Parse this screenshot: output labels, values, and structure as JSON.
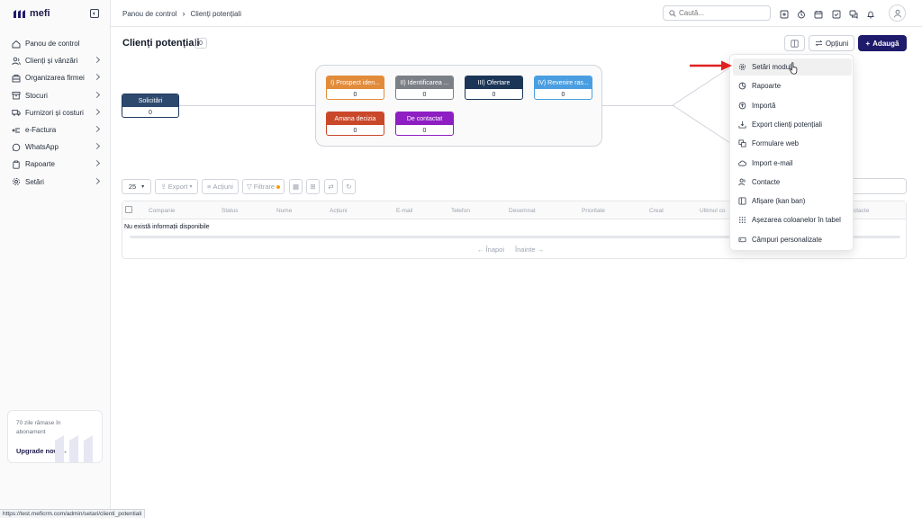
{
  "app": {
    "logo_text": "mefi"
  },
  "sidebar": {
    "items": [
      {
        "label": "Panou de control",
        "icon": "home-icon",
        "chevron": false
      },
      {
        "label": "Clienți și vânzări",
        "icon": "users-icon",
        "chevron": true
      },
      {
        "label": "Organizarea firmei",
        "icon": "building-icon",
        "chevron": true
      },
      {
        "label": "Stocuri",
        "icon": "box-icon",
        "chevron": true
      },
      {
        "label": "Furnizori și costuri",
        "icon": "truck-icon",
        "chevron": true
      },
      {
        "label": "e-Factura",
        "icon": "invoice-icon",
        "chevron": true
      },
      {
        "label": "WhatsApp",
        "icon": "whatsapp-icon",
        "chevron": true
      },
      {
        "label": "Rapoarte",
        "icon": "clipboard-icon",
        "chevron": true
      },
      {
        "label": "Setări",
        "icon": "gear-icon",
        "chevron": true
      }
    ],
    "upgrade": {
      "text": "70 zile rămase în abonament",
      "link": "Upgrade now"
    }
  },
  "topbar": {
    "breadcrumb": [
      "Panou de control",
      "Clienți potențiali"
    ],
    "search_placeholder": "Caută..."
  },
  "page": {
    "title": "Clienți potențiali",
    "count": "0",
    "options_label": "Opțiuni",
    "add_label": "Adaugă"
  },
  "funnel": {
    "source": {
      "label": "Solicitări",
      "value": "0",
      "color": "#2d4a6e"
    },
    "stages": [
      {
        "label": "I) Prospect iden...",
        "value": "0",
        "color": "#e28b3a"
      },
      {
        "label": "II) Identificarea ...",
        "value": "0",
        "color": "#7b7f86"
      },
      {
        "label": "III) Ofertare",
        "value": "0",
        "color": "#1b3556"
      },
      {
        "label": "IV) Revenire ras...",
        "value": "0",
        "color": "#4a9ee0"
      },
      {
        "label": "Amana decizia",
        "value": "0",
        "color": "#c9482a"
      },
      {
        "label": "De contactat",
        "value": "0",
        "color": "#8e1fc2"
      }
    ]
  },
  "table": {
    "page_size": "25",
    "toolbar": {
      "export": "Export",
      "actions": "Acțiuni",
      "filter": "Filtrare"
    },
    "columns": [
      "Companie",
      "Status",
      "Nume",
      "Acțiuni",
      "E-mail",
      "Telefon",
      "Desemnat",
      "Prioritate",
      "Creat",
      "Ultimul co",
      "ctacte"
    ],
    "empty_text": "Nu există informații disponibile",
    "pager": {
      "prev": "← Înapoi",
      "next": "Înainte →"
    }
  },
  "dropdown": {
    "items": [
      {
        "label": "Setări modul",
        "icon": "gear-icon",
        "highlighted": true
      },
      {
        "label": "Rapoarte",
        "icon": "pie-chart-icon",
        "highlighted": false
      },
      {
        "label": "Importă",
        "icon": "upload-icon",
        "highlighted": false
      },
      {
        "label": "Export clienți potențiali",
        "icon": "download-icon",
        "highlighted": false
      },
      {
        "label": "Formulare web",
        "icon": "forms-icon",
        "highlighted": false
      },
      {
        "label": "Import e-mail",
        "icon": "cloud-icon",
        "highlighted": false
      },
      {
        "label": "Contacte",
        "icon": "contacts-icon",
        "highlighted": false
      },
      {
        "label": "Afișare (kan ban)",
        "icon": "kanban-icon",
        "highlighted": false
      },
      {
        "label": "Așezarea coloanelor în tabel",
        "icon": "grid-dots-icon",
        "highlighted": false
      },
      {
        "label": "Câmpuri personalizate",
        "icon": "custom-fields-icon",
        "highlighted": false
      }
    ]
  },
  "statusbar": {
    "url": "https://test.meficrm.com/admin/setari/clienti_potentiali"
  },
  "colors": {
    "accent": "#1e1b6b",
    "arrow": "#e02020"
  }
}
